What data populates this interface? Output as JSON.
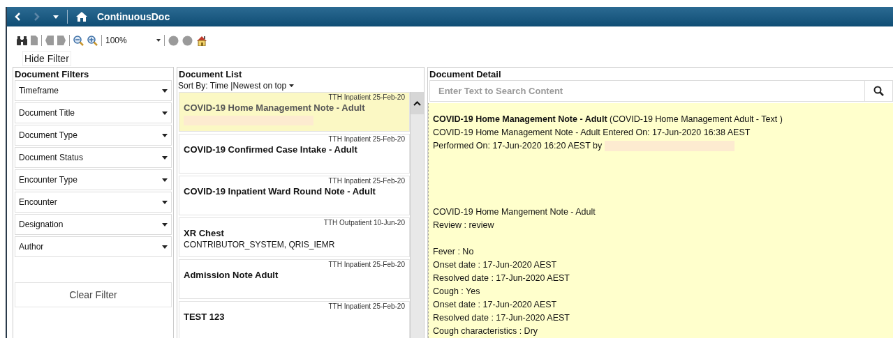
{
  "window": {
    "title": "ContinuousDoc"
  },
  "toolbar": {
    "zoom": "100%"
  },
  "hide_filter_button": "Hide Filter",
  "filters": {
    "title": "Document Filters",
    "items": [
      "Timeframe",
      "Document Title",
      "Document Type",
      "Document Status",
      "Encounter Type",
      "Encounter",
      "Designation",
      "Author"
    ],
    "clear_button": "Clear Filter"
  },
  "document_list": {
    "title": "Document List",
    "sort_by": "Sort By: Time |Newest on top",
    "items": [
      {
        "meta": "TTH Inpatient 25-Feb-20",
        "title": "COVID-19 Home Management Note - Adult",
        "selected": true,
        "redacted": true
      },
      {
        "meta": "TTH Inpatient 25-Feb-20",
        "title": "COVID-19 Confirmed Case Intake - Adult",
        "selected": false,
        "redacted": false
      },
      {
        "meta": "TTH Inpatient 25-Feb-20",
        "title": "COVID-19 Inpatient Ward Round Note - Adult",
        "selected": false,
        "redacted": false
      },
      {
        "meta": "TTH Outpatient 10-Jun-20",
        "title": "XR Chest",
        "subtitle": "CONTRIBUTOR_SYSTEM, QRIS_IEMR",
        "selected": false,
        "redacted": false
      },
      {
        "meta": "TTH Inpatient 25-Feb-20",
        "title": "Admission Note Adult",
        "selected": false,
        "redacted": false
      },
      {
        "meta": "TTH Inpatient 25-Feb-20",
        "title": "TEST 123",
        "selected": false,
        "redacted": false
      }
    ]
  },
  "document_detail": {
    "title": "Document Detail",
    "search": {
      "placeholder": "Enter Text to Search Content"
    },
    "sections": [
      {
        "lines": [
          {
            "text": "**COVID-19 Home Management Note - Adult** (COVID-19 Home Management Adult - Text )",
            "redacted": false
          },
          {
            "text": "COVID-19 Home Management Note - Adult Entered On: 17-Jun-2020 16:38 AEST",
            "redacted": false
          },
          {
            "text": "Performed On: 17-Jun-2020 16:20 AEST by",
            "redacted": true
          }
        ]
      },
      {
        "lines": [
          {
            "text": "COVID-19 Home Mangement Note - Adult",
            "redacted": false
          },
          {
            "text": "Review : review",
            "redacted": false
          }
        ]
      },
      {
        "lines": [
          {
            "text": "Fever : No",
            "redacted": false
          },
          {
            "text": "Onset date : 17-Jun-2020 AEST",
            "redacted": false
          },
          {
            "text": "Resolved date : 17-Jun-2020 AEST",
            "redacted": false
          },
          {
            "text": "Cough : Yes",
            "redacted": false
          },
          {
            "text": "Onset date : 17-Jun-2020 AEST",
            "redacted": false
          },
          {
            "text": "Resolved date : 17-Jun-2020 AEST",
            "redacted": false
          },
          {
            "text": "Cough characteristics : Dry",
            "redacted": false
          }
        ]
      }
    ]
  }
}
